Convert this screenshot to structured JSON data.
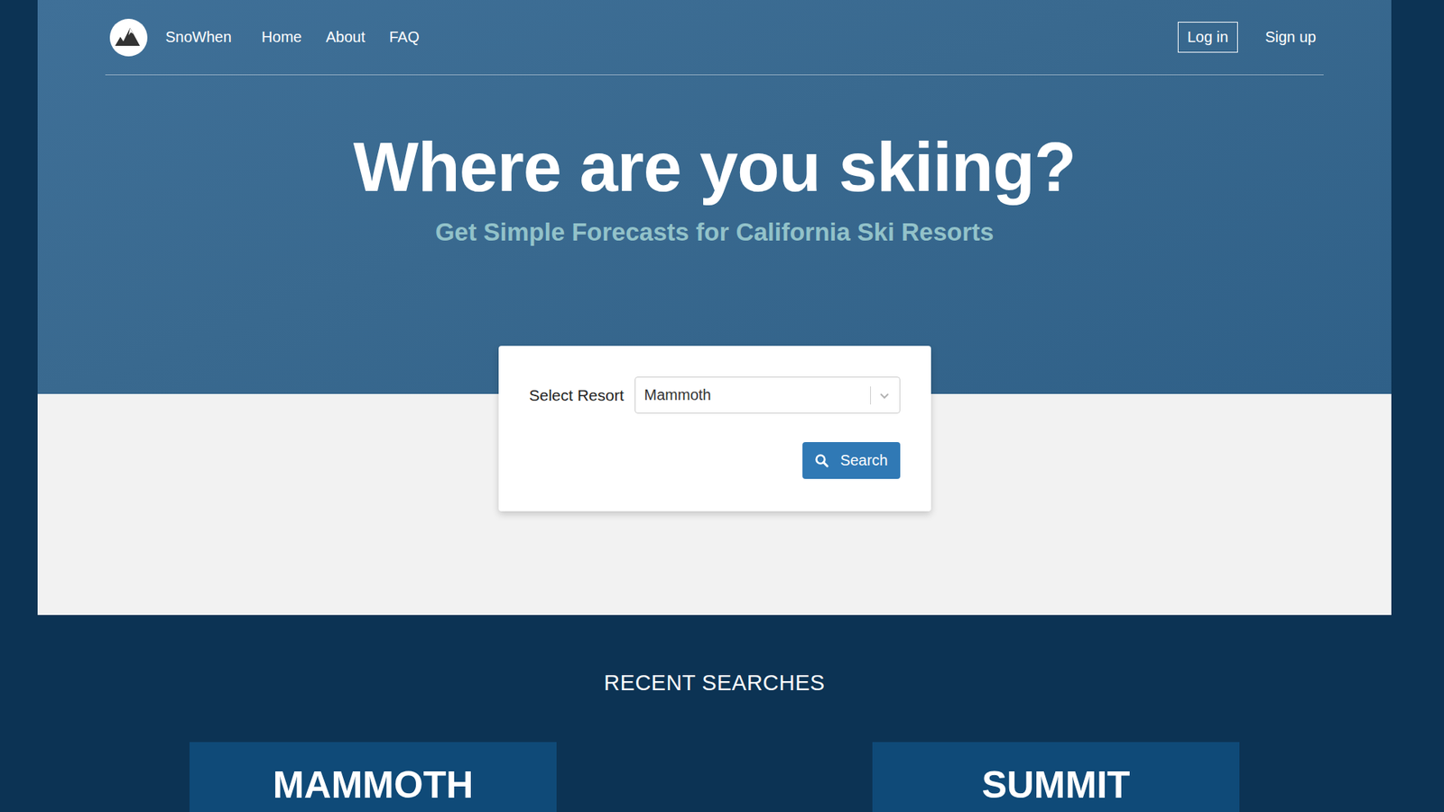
{
  "nav": {
    "brand": "SnoWhen",
    "links": [
      "Home",
      "About",
      "FAQ"
    ],
    "login": "Log in",
    "signup": "Sign up"
  },
  "hero": {
    "title": "Where are you skiing?",
    "subtitle": "Get Simple Forecasts for California Ski Resorts"
  },
  "form": {
    "label": "Select Resort",
    "value": "Mammoth",
    "button": "Search"
  },
  "recent": {
    "heading": "RECENT SEARCHES",
    "items": [
      "MAMMOTH",
      "SUMMIT"
    ]
  }
}
